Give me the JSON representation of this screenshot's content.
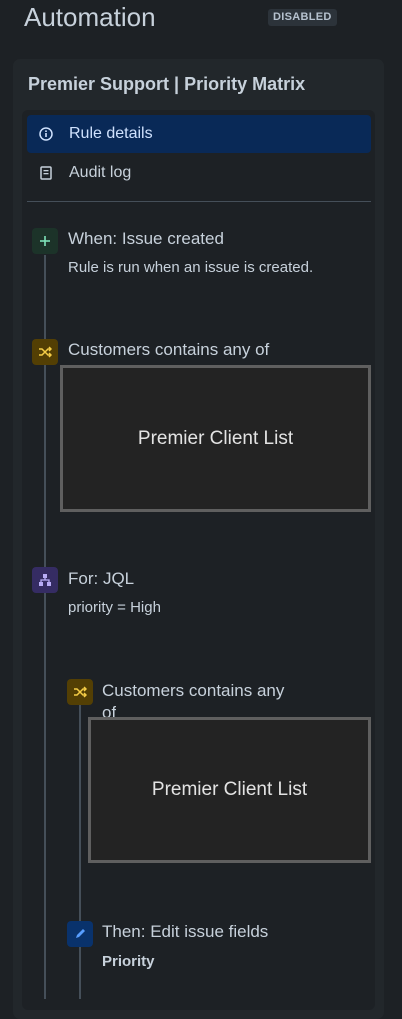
{
  "header": {
    "title": "Automation",
    "status_badge": "DISABLED"
  },
  "rule": {
    "name": "Premier Support | Priority Matrix",
    "nav": [
      {
        "label": "Rule details",
        "icon": "info-icon",
        "selected": true
      },
      {
        "label": "Audit log",
        "icon": "document-icon",
        "selected": false
      }
    ]
  },
  "steps": {
    "trigger": {
      "title": "When: Issue created",
      "description": "Rule is run when an issue is created.",
      "icon": "plus-icon"
    },
    "condition1": {
      "title": "Customers contains any of",
      "value": "Premier Client List",
      "icon": "shuffle-icon"
    },
    "branch": {
      "title": "For: JQL",
      "description": "priority = High",
      "icon": "hierarchy-icon"
    },
    "condition2": {
      "title_line1": "Customers contains any",
      "title_line2": "of",
      "value": "Premier Client List",
      "icon": "shuffle-icon"
    },
    "action": {
      "title": "Then: Edit issue fields",
      "field": "Priority",
      "icon": "pencil-icon"
    }
  },
  "colors": {
    "background": "#1d2125",
    "selected_nav": "#092957",
    "trigger_icon": "#1c3329",
    "condition_icon": "#533f04",
    "branch_icon": "#352c63",
    "action_icon": "#09326c"
  }
}
